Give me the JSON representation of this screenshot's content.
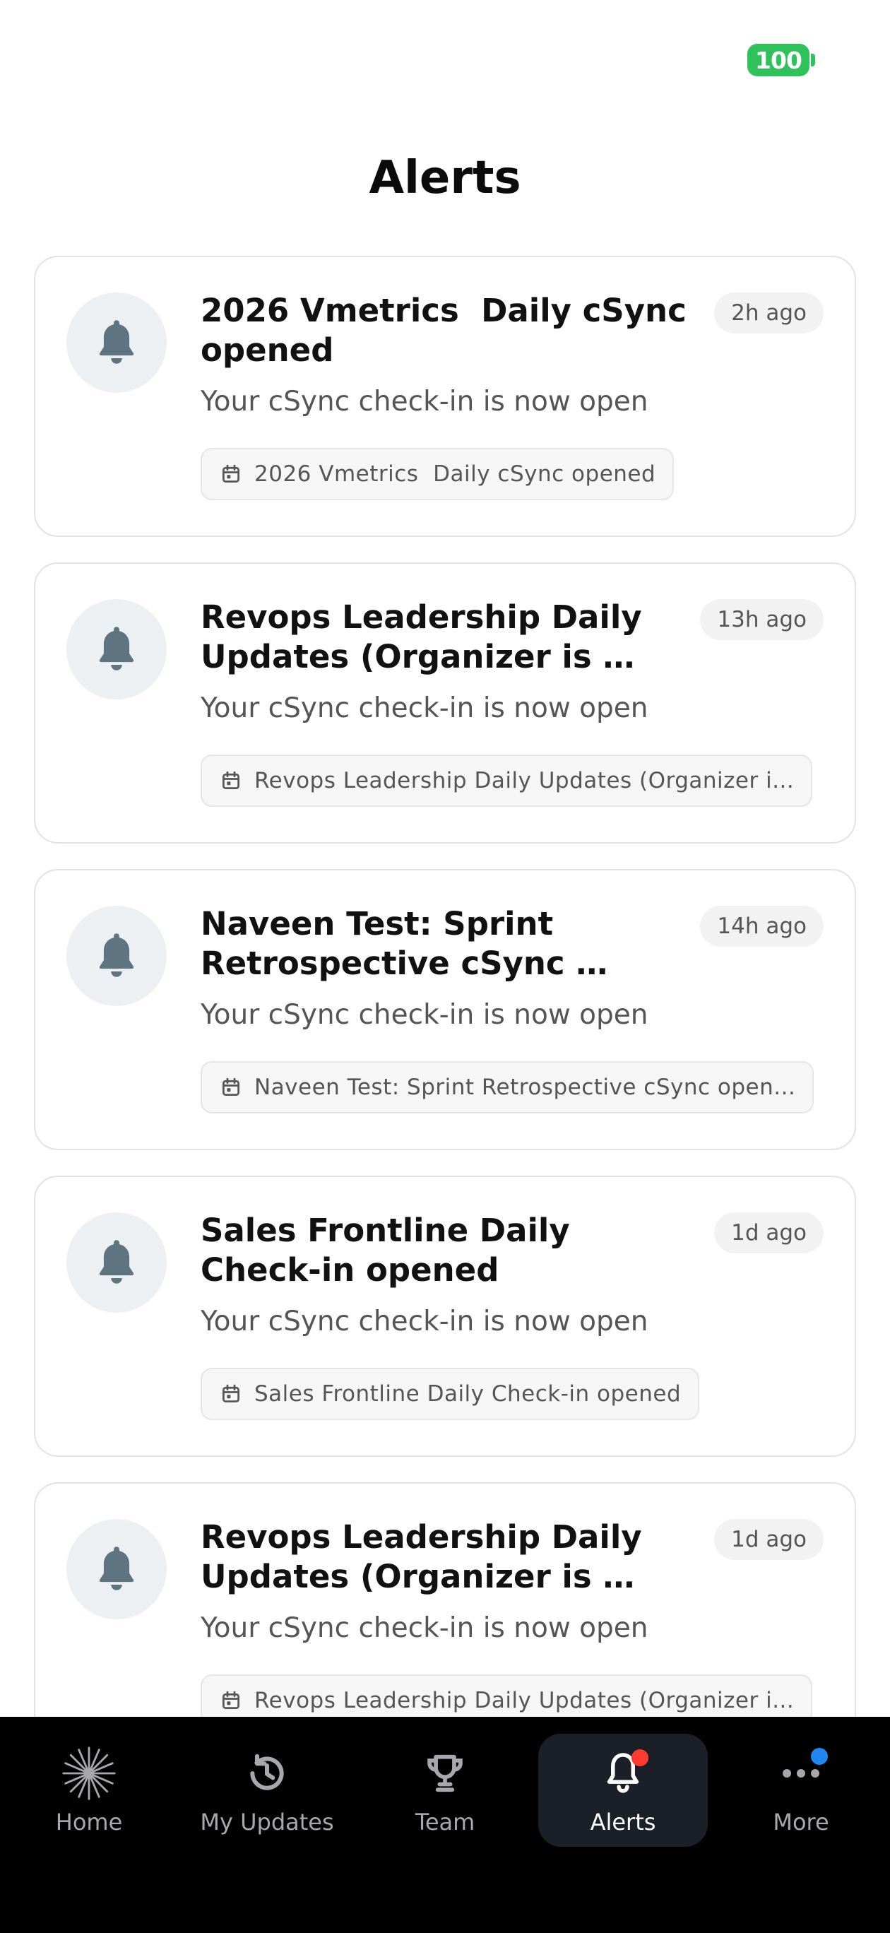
{
  "status": {
    "battery": "100"
  },
  "page": {
    "title": "Alerts"
  },
  "alerts": [
    {
      "title": "2026 Vmetrics  Daily cSync opened",
      "time": "2h ago",
      "subtitle": "Your cSync check-in is now open",
      "tag": "2026 Vmetrics  Daily cSync opened"
    },
    {
      "title": "Revops Leadership Daily Updates (Organizer is part...",
      "time": "13h ago",
      "subtitle": "Your cSync check-in is now open",
      "tag": "Revops Leadership Daily Updates (Organizer i..."
    },
    {
      "title": "Naveen Test: Sprint Retrospective cSync open...",
      "time": "14h ago",
      "subtitle": "Your cSync check-in is now open",
      "tag": "Naveen Test: Sprint Retrospective cSync open..."
    },
    {
      "title": "Sales Frontline Daily Check-in opened",
      "time": "1d ago",
      "subtitle": "Your cSync check-in is now open",
      "tag": "Sales Frontline Daily Check-in opened"
    },
    {
      "title": "Revops Leadership Daily Updates (Organizer is parti...",
      "time": "1d ago",
      "subtitle": "Your cSync check-in is now open",
      "tag": "Revops Leadership Daily Updates (Organizer i..."
    }
  ],
  "nav": {
    "home": "Home",
    "updates": "My Updates",
    "team": "Team",
    "alerts": "Alerts",
    "more": "More"
  },
  "colors": {
    "battery": "#2fc25b",
    "bell": "#5e7480",
    "alert_dot": "#ff3b30",
    "more_dot": "#1e88f0"
  }
}
